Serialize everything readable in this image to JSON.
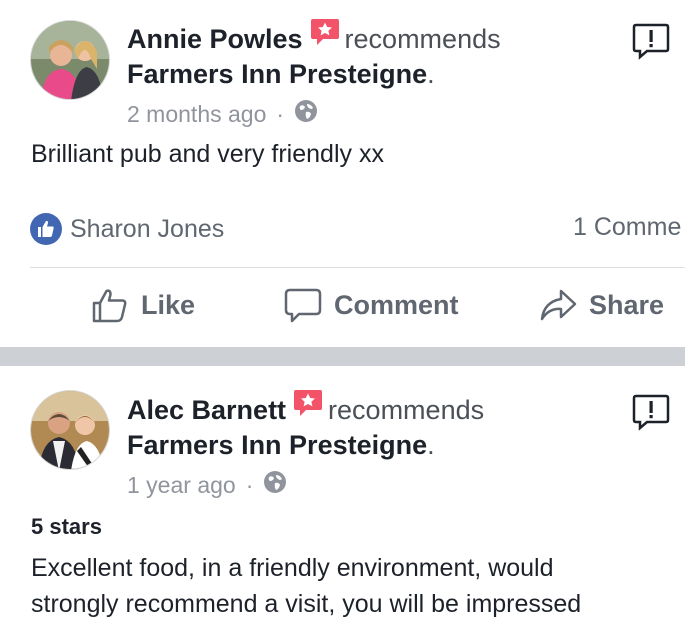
{
  "posts": [
    {
      "author": "Annie Powles",
      "verb": "recommends",
      "place": "Farmers Inn Presteigne",
      "place_punct": ".",
      "time": "2 months ago",
      "separator": "·",
      "text_lines": [
        "Brilliant pub and very friendly xx"
      ],
      "reaction_name": "Sharon Jones",
      "comments": "1 Comme",
      "icons": {
        "badge": "recommend-badge-icon",
        "privacy": "globe-icon",
        "menu": "report-icon",
        "reaction": "like-reaction-icon"
      }
    },
    {
      "author": "Alec Barnett",
      "verb": "recommends",
      "place": "Farmers Inn Presteigne",
      "place_punct": ".",
      "time": "1 year ago",
      "separator": "·",
      "rating": "5 stars",
      "text_lines": [
        "Excellent food, in a friendly environment, would",
        "strongly recommend a visit, you will be impressed"
      ]
    }
  ],
  "actions": {
    "like": "Like",
    "comment": "Comment",
    "share": "Share"
  },
  "colors": {
    "badge": "#f35369",
    "like_blue": "#4267b2",
    "text": "#1d2129",
    "muted": "#90949c",
    "separator_bar": "#cdd0d5"
  }
}
